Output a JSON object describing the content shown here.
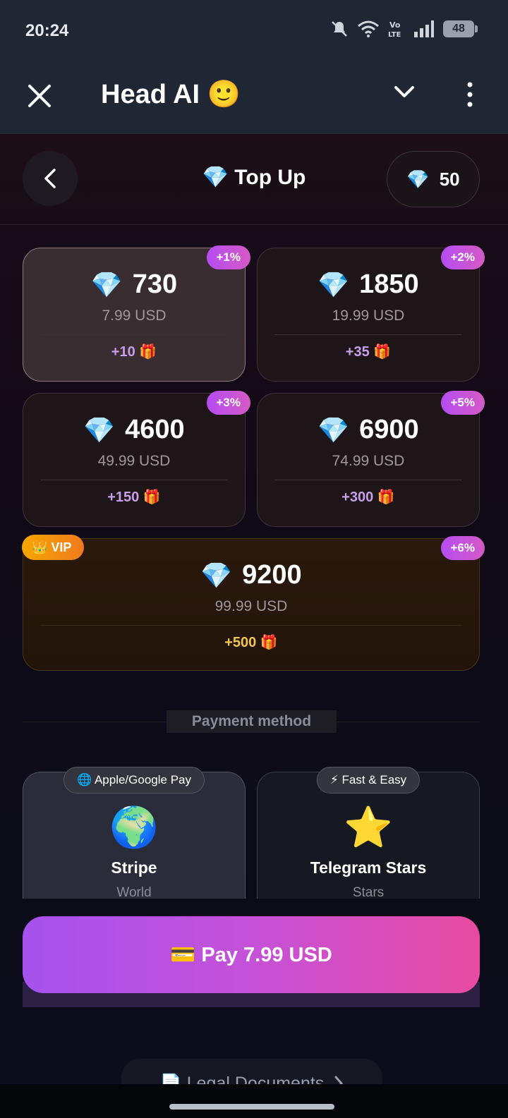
{
  "status_bar": {
    "time": "20:24",
    "battery": "48"
  },
  "app_bar": {
    "title": "Head AI 🙂"
  },
  "header": {
    "title": "💎 Top Up",
    "balance": "50"
  },
  "packages": [
    {
      "amount": "730",
      "price": "7.99 USD",
      "bonus": "+10 🎁",
      "percent": "+1%",
      "selected": true
    },
    {
      "amount": "1850",
      "price": "19.99 USD",
      "bonus": "+35 🎁",
      "percent": "+2%",
      "selected": false
    },
    {
      "amount": "4600",
      "price": "49.99 USD",
      "bonus": "+150 🎁",
      "percent": "+3%",
      "selected": false
    },
    {
      "amount": "6900",
      "price": "74.99 USD",
      "bonus": "+300 🎁",
      "percent": "+5%",
      "selected": false
    },
    {
      "amount": "9200",
      "price": "99.99 USD",
      "bonus": "+500 🎁",
      "percent": "+6%",
      "badge": "👑 VIP",
      "selected": false
    }
  ],
  "payment": {
    "label": "Payment method",
    "methods": [
      {
        "tag": "🌐 Apple/Google Pay",
        "icon": "🌍",
        "name": "Stripe",
        "sub": "World",
        "selected": true
      },
      {
        "tag": "⚡ Fast & Easy",
        "icon": "⭐",
        "name": "Telegram Stars",
        "sub": "Stars",
        "selected": false
      }
    ]
  },
  "pay_button": {
    "label": "💳 Pay 7.99 USD"
  },
  "legal": {
    "label": "📄 Legal Documents"
  },
  "colors": {
    "accent_start": "#a652ee",
    "accent_end": "#e74aa0",
    "vip": "#f7a600",
    "bonus_text": "#c79ee9"
  }
}
